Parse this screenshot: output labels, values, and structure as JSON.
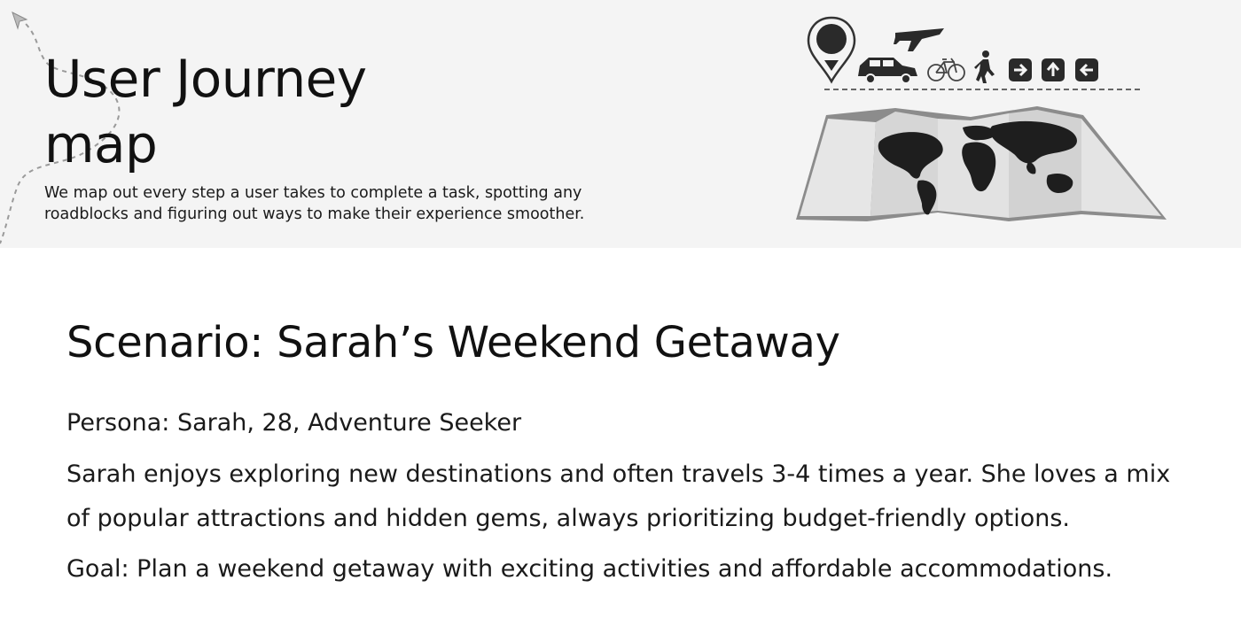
{
  "header": {
    "title_line1": "User Journey",
    "title_line2": "map",
    "subtitle": "We map out every step a user takes to complete a task, spotting any roadblocks and figuring out ways to make their experience smoother."
  },
  "illustration": {
    "icons": [
      "map-pin-icon",
      "car-icon",
      "airplane-icon",
      "bicycle-icon",
      "walking-person-icon",
      "arrow-right-icon",
      "arrow-up-icon",
      "arrow-left-icon",
      "world-map-icon"
    ]
  },
  "scenario": {
    "prefix": "Scenario:",
    "title": " Sarah’s Weekend Getaway",
    "persona": "Persona: Sarah, 28, Adventure Seeker",
    "description": "Sarah enjoys exploring new destinations and often travels 3-4 times a year. She loves a mix of popular attractions and hidden gems, always prioritizing budget-friendly options.",
    "goal_label": "Goal",
    "goal_text": ": Plan a weekend getaway with exciting activities and affordable accommodations."
  }
}
